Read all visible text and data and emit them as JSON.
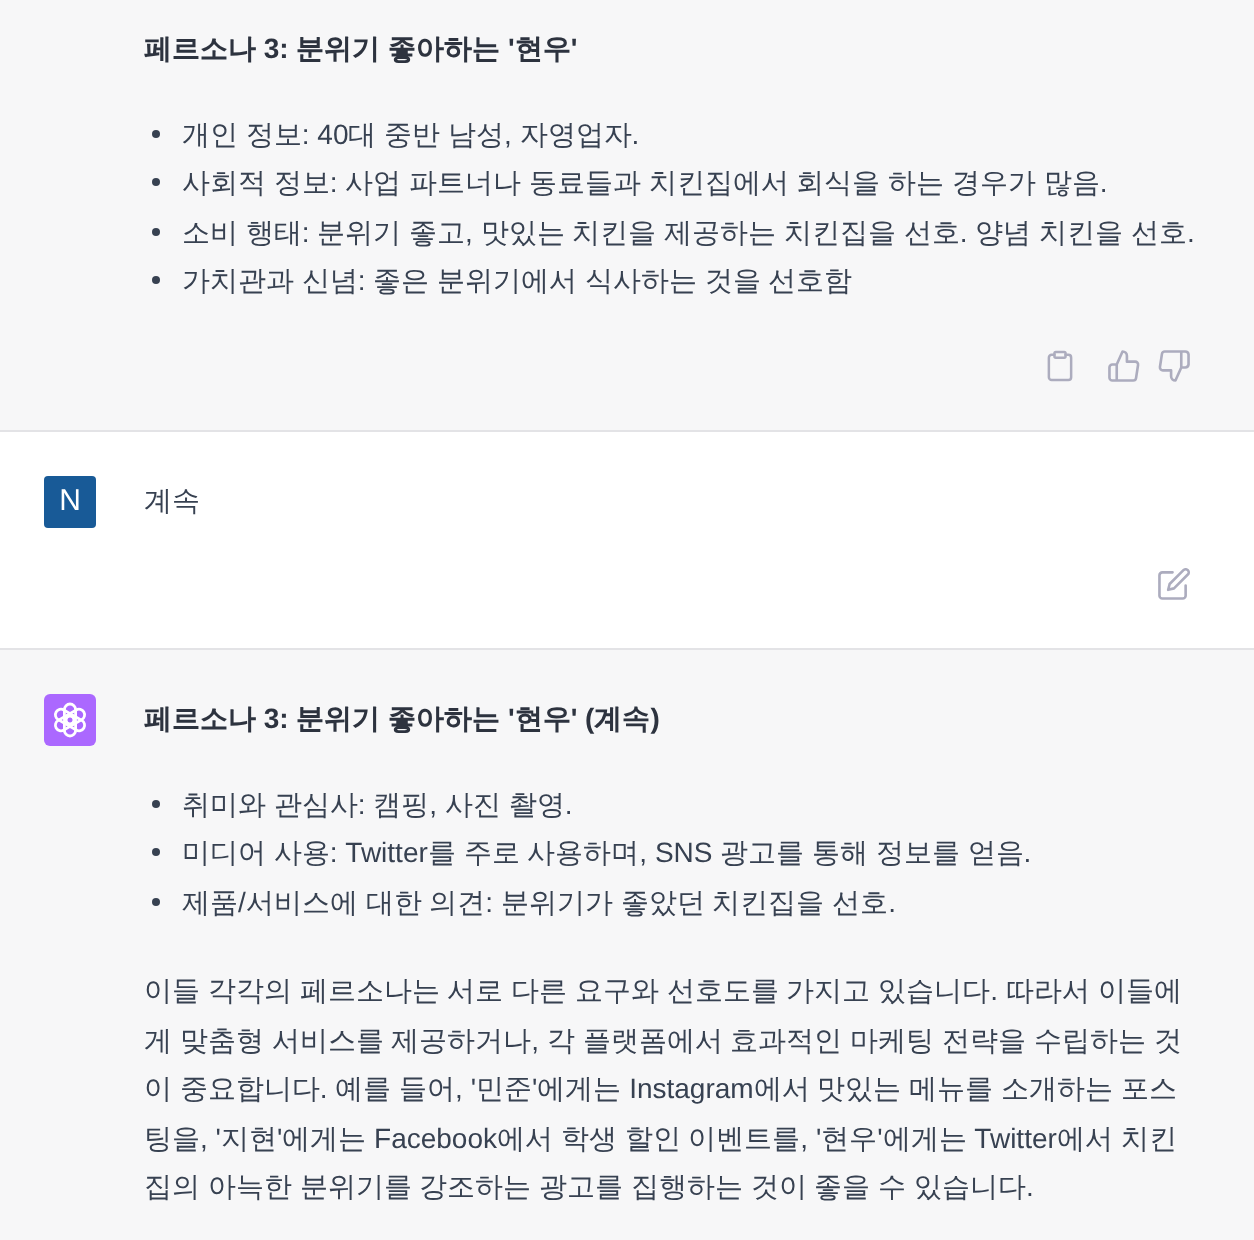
{
  "messages": [
    {
      "kind": "assistant",
      "blocks": [
        {
          "kind": "heading",
          "text": "페르소나 3: 분위기 좋아하는 '현우'"
        },
        {
          "kind": "list",
          "items": [
            "개인 정보: 40대 중반 남성, 자영업자.",
            "사회적 정보: 사업 파트너나 동료들과 치킨집에서 회식을 하는 경우가 많음.",
            "소비 행태: 분위기 좋고, 맛있는 치킨을 제공하는 치킨집을 선호. 양념 치킨을 선호.",
            "가치관과 신념: 좋은 분위기에서 식사하는 것을 선호함"
          ]
        }
      ],
      "actions": [
        {
          "kind": "copy"
        },
        {
          "kind": "like"
        },
        {
          "kind": "dislike"
        }
      ]
    },
    {
      "kind": "user",
      "avatar": {
        "kind": "letter",
        "letter": "N"
      },
      "blocks": [
        {
          "kind": "paragraph",
          "text": "계속"
        }
      ],
      "actions": [
        {
          "kind": "edit"
        }
      ]
    },
    {
      "kind": "assistant",
      "avatar": {
        "kind": "logo"
      },
      "blocks": [
        {
          "kind": "heading",
          "text": "페르소나 3: 분위기 좋아하는 '현우' (계속)"
        },
        {
          "kind": "list",
          "items": [
            "취미와 관심사: 캠핑, 사진 촬영.",
            "미디어 사용: Twitter를 주로 사용하며, SNS 광고를 통해 정보를 얻음.",
            "제품/서비스에 대한 의견: 분위기가 좋았던 치킨집을 선호."
          ]
        },
        {
          "kind": "paragraph",
          "text": "이들 각각의 페르소나는 서로 다른 요구와 선호도를 가지고 있습니다. 따라서 이들에게 맞춤형 서비스를 제공하거나, 각 플랫폼에서 효과적인 마케팅 전략을 수립하는 것이 중요합니다. 예를 들어, '민준'에게는 Instagram에서 맛있는 메뉴를 소개하는 포스팅을, '지현'에게는 Facebook에서 학생 할인 이벤트를, '현우'에게는 Twitter에서 치킨집의 아늑한 분위기를 강조하는 광고를 집행하는 것이 좋을 수 있습니다."
        }
      ]
    }
  ]
}
